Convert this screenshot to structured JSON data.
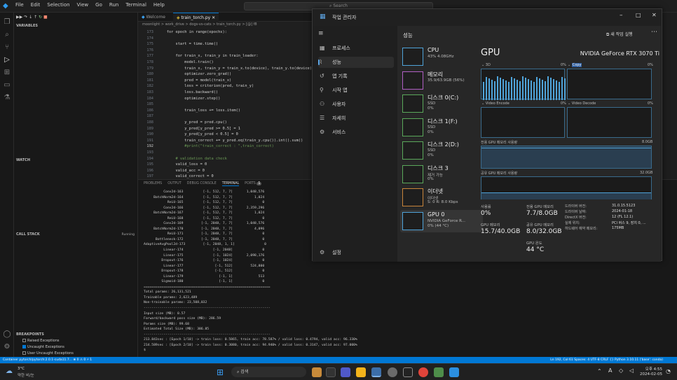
{
  "vscode": {
    "menu": [
      "File",
      "Edit",
      "Selection",
      "View",
      "Go",
      "Run",
      "Terminal",
      "Help"
    ],
    "search_placeholder": "Search",
    "sidebar": {
      "variables": "VARIABLES",
      "watch": "WATCH",
      "call_stack": "CALL STACK",
      "call_stack_status": "Running",
      "breakpoints": "BREAKPOINTS",
      "bp_items": [
        "Raised Exceptions",
        "Uncaught Exceptions",
        "User Uncaught Exceptions"
      ]
    },
    "tabs": {
      "welcome": "Welcome",
      "active": "train_torch.py"
    },
    "breadcrumb": "moonlight > work_drive > dogs-vs-cats > train_torch.py > [@] f8",
    "code": {
      "line_numbers": [
        "173",
        "174",
        "175",
        "176",
        "177",
        "178",
        "179",
        "180",
        "181",
        "182",
        "183",
        "184",
        "185",
        "186",
        "187",
        "188",
        "189",
        "190",
        "191",
        "192",
        "193",
        "194",
        "195",
        "196",
        "197",
        "198"
      ],
      "lines": [
        "    for epoch in range(epochs):",
        "",
        "        start = time.time()",
        "",
        "        for train_x, train_y in train_loader:",
        "            model.train()",
        "            train_x, train_y = train_x.to(device), train_y.to(device)",
        "            optimizer.zero_grad()",
        "            pred = model(train_x)",
        "            loss = criterion(pred, train_y)",
        "            loss.backward()",
        "            optimizer.step()",
        "",
        "            train_loss += loss.item()",
        "",
        "            y_pred = pred.cpu()",
        "            y_pred[y_pred >= 0.5] = 1",
        "            y_pred[y_pred < 0.5] = 0",
        "            train_correct += y_pred.eq(train_y.cpu()).int().sum()",
        "            #print(\"train_correct : \",train_correct)",
        "",
        "        # validation data check",
        "        valid_loss = 0",
        "        valid_acc = 0",
        "        valid_correct = 0",
        "        for valid_x, valid_y in valid_loader:"
      ]
    },
    "panel_tabs": [
      "PROBLEMS",
      "OUTPUT",
      "DEBUG CONSOLE",
      "TERMINAL",
      "PORTS"
    ],
    "ports_badge": "1",
    "terminal_lines": [
      "          Conv2d-163          [-1, 512, 7, 7]       1,048,576",
      "     BatchNorm2d-164          [-1, 512, 7, 7]           1,024",
      "            ReLU-165          [-1, 512, 7, 7]               0",
      "          Conv2d-166          [-1, 512, 7, 7]       2,359,296",
      "     BatchNorm2d-167          [-1, 512, 7, 7]           1,024",
      "            ReLU-168          [-1, 512, 7, 7]               0",
      "          Conv2d-169         [-1, 2048, 7, 7]       1,048,576",
      "     BatchNorm2d-170         [-1, 2048, 7, 7]           4,096",
      "            ReLU-171         [-1, 2048, 7, 7]               0",
      "      Bottleneck-172         [-1, 2048, 7, 7]               0",
      "AdaptiveAvgPool2d-173         [-1, 2048, 1, 1]               0",
      "          Linear-174               [-1, 2048]               0",
      "          Linear-175               [-1, 1024]       2,098,176",
      "         Dropout-176               [-1, 1024]               0",
      "          Linear-177                [-1, 512]         524,800",
      "         Dropout-178                [-1, 512]               0",
      "          Linear-179                  [-1, 1]             513",
      "         Sigmoid-180                  [-1, 1]               0",
      "================================================================",
      "Total params: 26,131,521",
      "Trainable params: 2,623,489",
      "Non-trainable params: 23,508,032",
      "----------------------------------------------------------------",
      "Input size (MB): 0.57",
      "Forward/backward pass size (MB): 286.59",
      "Params size (MB): 99.68",
      "Estimated Total Size (MB): 386.85",
      "----------------------------------------------------------------",
      "213.843sec : [Epoch 1/10] -> train loss: 0.5865, train acc: 78.587% / valid loss: 0.4794, valid acc: 96.330%",
      "214.589sec : [Epoch 2/10] -> train loss: 0.3080, train acc: 94.940% / valid loss: 0.3147, valid acc: 97.000%",
      "$"
    ],
    "status_left": "Container pytorch/pytorch:2.0.1-cuda11.7...   ⊗ 0 ⚠ 0   ⚡ 1",
    "status_right": "Ln 192, Col 61   Spaces: 4   UTF-8   CRLF   {} Python   3.10.11 ('base': conda)"
  },
  "task_manager": {
    "title": "작업 관리자",
    "section_title": "성능",
    "new_task": "새 작업 실행",
    "nav": [
      "프로세스",
      "성능",
      "앱 기록",
      "시작 앱",
      "사용자",
      "자세히",
      "서비스"
    ],
    "nav_selected": 1,
    "settings": "설정",
    "devices": [
      {
        "name": "CPU",
        "line2": "43% 4.08GHz",
        "line3": ""
      },
      {
        "name": "메모리",
        "line2": "35.9/63.9GB (56%)",
        "line3": ""
      },
      {
        "name": "디스크 0(C:)",
        "line2": "SSD",
        "line3": "0%"
      },
      {
        "name": "디스크 1(F:)",
        "line2": "SSD",
        "line3": "0%"
      },
      {
        "name": "디스크 2(D:)",
        "line2": "SSD",
        "line3": "0%"
      },
      {
        "name": "디스크 3",
        "line2": "제거 가능",
        "line3": "0%"
      },
      {
        "name": "이더넷",
        "line2": "이더넷",
        "line3": "S: 0 R: 8.0 Kbps"
      },
      {
        "name": "GPU 0",
        "line2": "NVIDIA GeForce R...",
        "line3": "0% (44 °C)"
      }
    ],
    "gpu": {
      "title": "GPU",
      "model": "NVIDIA GeForce RTX 3070 Ti",
      "g1_label": "3D",
      "g1_pct": "0%",
      "g2_label": "Copy",
      "g2_pct": "0%",
      "g3_label": "Video Encode",
      "g3_pct": "0%",
      "g4_label": "Video Decode",
      "g4_pct": "0%",
      "dedicated_label": "전용 GPU 메모리 사용량",
      "dedicated_max": "8.0GB",
      "shared_label": "공유 GPU 메모리 사용량",
      "shared_max": "32.0GB",
      "stats": {
        "util_label": "사용률",
        "util": "0%",
        "ded_label": "전용 GPU 메모리",
        "ded": "7.7/8.0GB",
        "gpu_mem_label": "GPU 메모리",
        "gpu_mem": "15.7/40.0GB",
        "shared_mem_label": "공유 GPU 메모리",
        "shared_mem": "8.0/32.0GB",
        "temp_label": "GPU 온도",
        "temp": "44 °C"
      },
      "info": [
        {
          "k": "드라이버 버전:",
          "v": "31.0.15.5123"
        },
        {
          "k": "드라이버 날짜:",
          "v": "2024-01-18"
        },
        {
          "k": "DirectX 버전:",
          "v": "12 (FL 12.1)"
        },
        {
          "k": "실제 위치:",
          "v": "PCI 버스 9, 장치 0, ..."
        },
        {
          "k": "하드웨어 예약 메모리:",
          "v": "175MB"
        }
      ]
    }
  },
  "taskbar": {
    "weather_temp": "3°C",
    "weather_desc": "약한 비/눈",
    "search": "검색",
    "time": "오후 4:55",
    "date": "2024-02-05",
    "lang": "A"
  },
  "colors": {
    "accent": "#0078d4",
    "graph": "#4fa3d9"
  }
}
